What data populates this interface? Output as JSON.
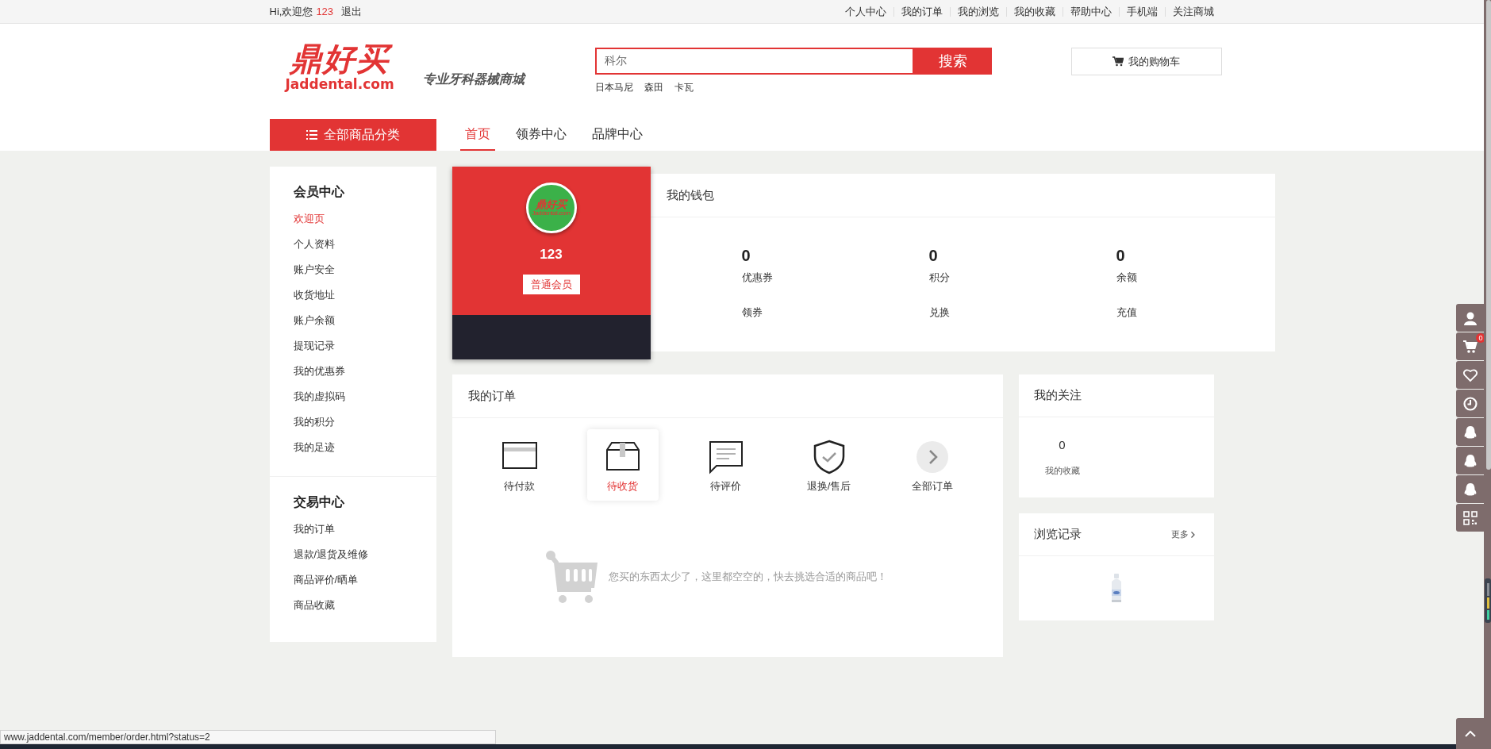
{
  "top_bar": {
    "greeting": "Hi,欢迎您",
    "username": "123",
    "logout": "退出",
    "links": [
      "个人中心",
      "我的订单",
      "我的浏览",
      "我的收藏",
      "帮助中心",
      "手机端",
      "关注商城"
    ]
  },
  "header": {
    "logo_text": "鼎好买",
    "logo_domain": "Jaddental.com",
    "tagline": "专业牙科器械商城",
    "search": {
      "value": "科尔",
      "button": "搜索"
    },
    "hot_words": [
      "日本马尼",
      "森田",
      "卡瓦"
    ],
    "cart_button": "我的购物车"
  },
  "nav": {
    "category_button": "全部商品分类",
    "tabs": [
      {
        "label": "首页",
        "selected": true
      },
      {
        "label": "领券中心",
        "selected": false
      },
      {
        "label": "品牌中心",
        "selected": false
      }
    ]
  },
  "sidebar": {
    "sections": [
      {
        "title": "会员中心",
        "items": [
          {
            "label": "欢迎页",
            "selected": true
          },
          {
            "label": "个人资料",
            "selected": false
          },
          {
            "label": "账户安全",
            "selected": false
          },
          {
            "label": "收货地址",
            "selected": false
          },
          {
            "label": "账户余额",
            "selected": false
          },
          {
            "label": "提现记录",
            "selected": false
          },
          {
            "label": "我的优惠券",
            "selected": false
          },
          {
            "label": "我的虚拟码",
            "selected": false
          },
          {
            "label": "我的积分",
            "selected": false
          },
          {
            "label": "我的足迹",
            "selected": false
          }
        ]
      },
      {
        "title": "交易中心",
        "items": [
          {
            "label": "我的订单",
            "selected": false
          },
          {
            "label": "退款/退货及维修",
            "selected": false
          },
          {
            "label": "商品评价/晒单",
            "selected": false
          },
          {
            "label": "商品收藏",
            "selected": false
          }
        ]
      }
    ]
  },
  "profile": {
    "avatar_text": "鼎好买",
    "avatar_subtext": "Jaddental.com",
    "username": "123",
    "level_badge": "普通会员"
  },
  "wallet": {
    "title": "我的钱包",
    "stats": [
      {
        "value": "0",
        "label": "优惠券",
        "action": "领券"
      },
      {
        "value": "0",
        "label": "积分",
        "action": "兑换"
      },
      {
        "value": "0",
        "label": "余额",
        "action": "充值"
      }
    ]
  },
  "orders": {
    "title": "我的订单",
    "statuses": [
      {
        "kind": "card",
        "label": "待付款",
        "selected": false
      },
      {
        "kind": "box",
        "label": "待收货",
        "selected": true
      },
      {
        "kind": "chat",
        "label": "待评价",
        "selected": false
      },
      {
        "kind": "shield",
        "label": "退换/售后",
        "selected": false
      },
      {
        "kind": "arrow",
        "label": "全部订单",
        "selected": false
      }
    ],
    "empty_message": "您买的东西太少了，这里都空空的，快去挑选合适的商品吧！"
  },
  "following": {
    "title": "我的关注",
    "count": "0",
    "label": "我的收藏"
  },
  "history": {
    "title": "浏览记录",
    "more": "更多"
  },
  "float_toolbar": {
    "items": [
      {
        "kind": "user"
      },
      {
        "kind": "cart",
        "badge": "0"
      },
      {
        "kind": "heart"
      },
      {
        "kind": "clock"
      },
      {
        "kind": "qq"
      },
      {
        "kind": "qq"
      },
      {
        "kind": "qq"
      },
      {
        "kind": "qr"
      }
    ]
  },
  "status_url": "www.jaddental.com/member/order.html?status=2"
}
